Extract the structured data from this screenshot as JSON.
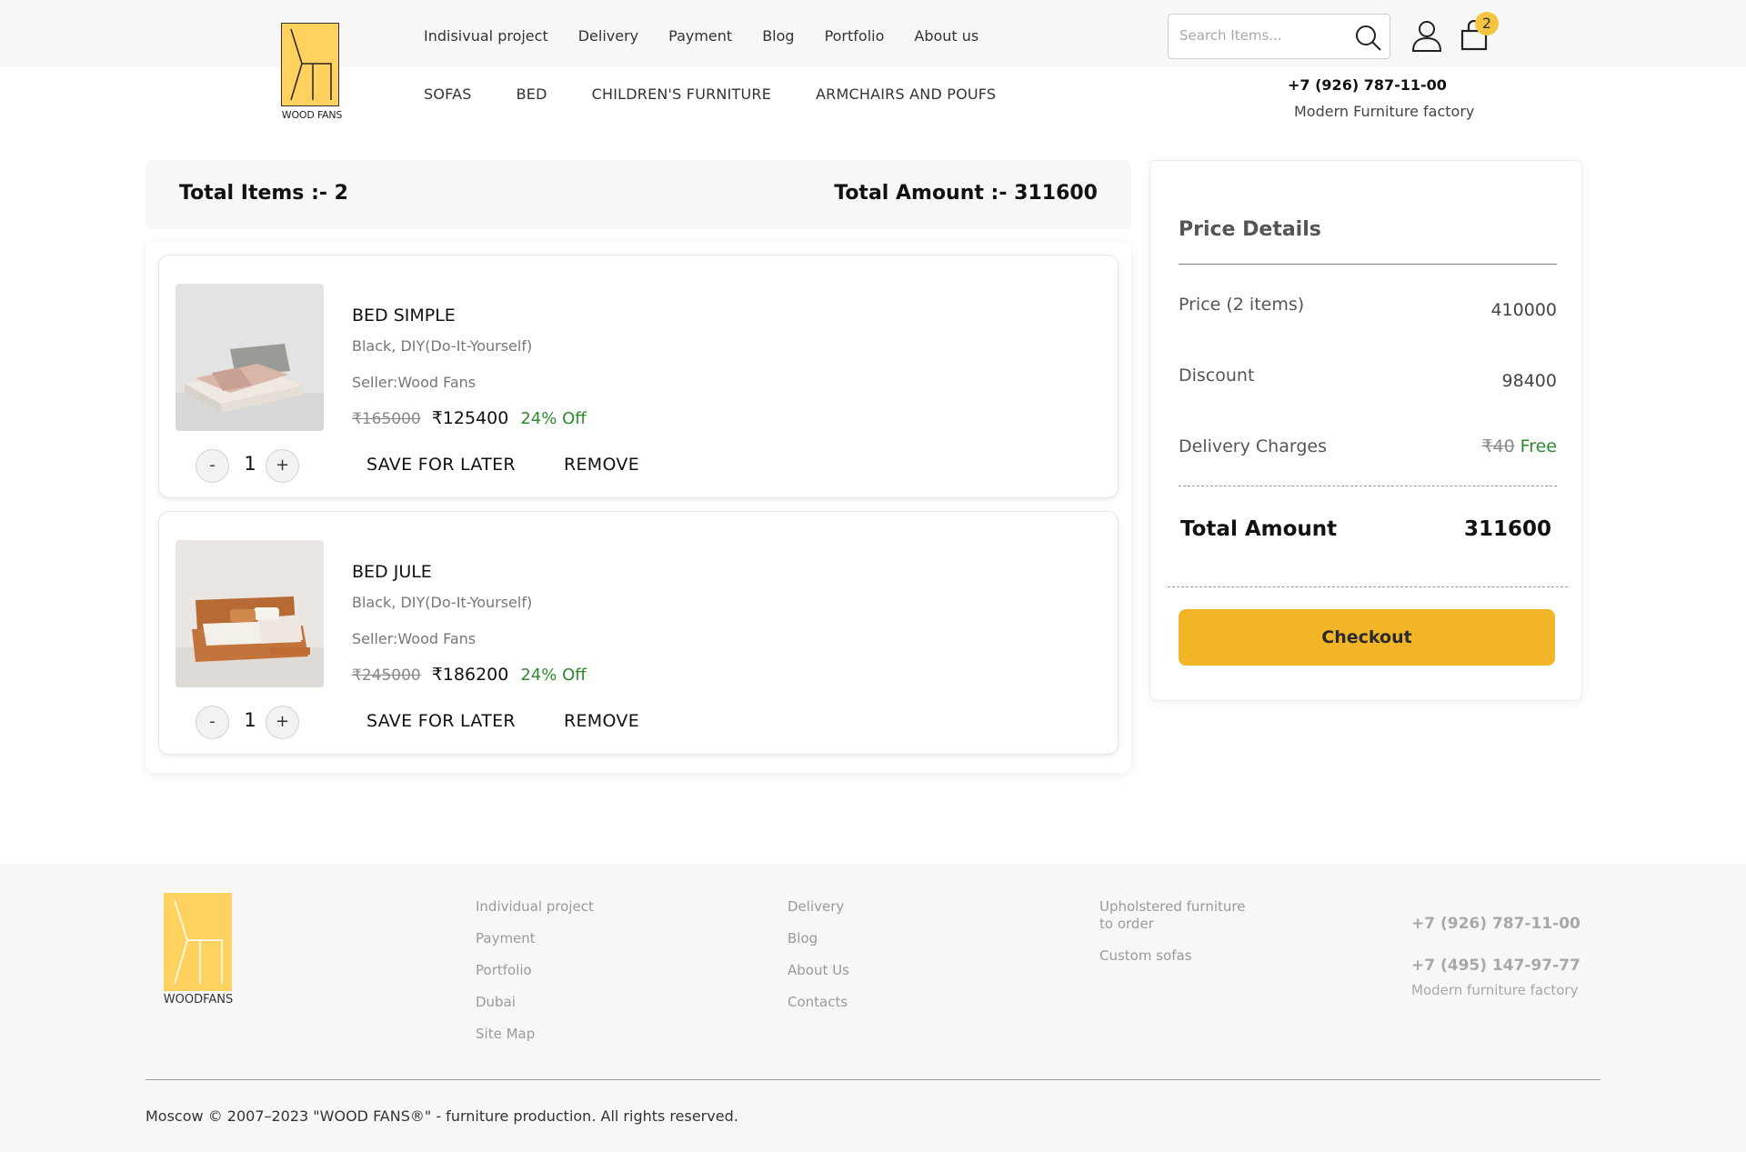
{
  "header": {
    "logo_text": "WOOD FANS",
    "nav_top": [
      "Indisivual project",
      "Delivery",
      "Payment",
      "Blog",
      "Portfolio",
      "About us"
    ],
    "nav_categories": [
      "SOFAS",
      "BED",
      "CHILDREN'S FURNITURE",
      "ARMCHAIRS AND POUFS"
    ],
    "search_placeholder": "Search Items...",
    "cart_count": "2",
    "phone": "+7 (926) 787-11-00",
    "tagline": "Modern Furniture factory"
  },
  "cart": {
    "total_items_label": "Total Items :- 2",
    "total_amount_label": "Total Amount :- 311600",
    "items": [
      {
        "name": "BED SIMPLE",
        "variant": "Black, DIY(Do-It-Yourself)",
        "seller": "Seller:Wood Fans",
        "old_price": "₹165000",
        "price": "₹125400",
        "discount": "24% Off",
        "qty": "1",
        "minus": "-",
        "plus": "+",
        "save_label": "SAVE FOR LATER",
        "remove_label": "REMOVE"
      },
      {
        "name": "BED JULE",
        "variant": "Black, DIY(Do-It-Yourself)",
        "seller": "Seller:Wood Fans",
        "old_price": "₹245000",
        "price": "₹186200",
        "discount": "24% Off",
        "qty": "1",
        "minus": "-",
        "plus": "+",
        "save_label": "SAVE FOR LATER",
        "remove_label": "REMOVE"
      }
    ]
  },
  "price_details": {
    "title": "Price Details",
    "price_label": "Price (2 items)",
    "price_value": "410000",
    "discount_label": "Discount",
    "discount_value": "98400",
    "delivery_label": "Delivery Charges",
    "delivery_old": "₹40",
    "delivery_value": "Free",
    "total_label": "Total Amount",
    "total_value": "311600",
    "checkout_label": "Checkout"
  },
  "footer": {
    "logo_text": "WOODFANS",
    "col1": [
      "Individual project",
      "Payment",
      "Portfolio",
      "Dubai",
      "Site Map"
    ],
    "col2": [
      "Delivery",
      "Blog",
      "About Us",
      "Contacts"
    ],
    "col3": [
      "Upholstered furniture to order",
      "Custom sofas"
    ],
    "phone1": "+7 (926) 787-11-00",
    "phone2": "+7 (495) 147-97-77",
    "tagline": "Modern furniture factory",
    "copyright": "Moscow © 2007–2023 \"WOOD FANS®\" - furniture production. All rights reserved."
  },
  "colors": {
    "accent": "#f3b528",
    "logo_yellow": "#ffd25f",
    "discount_green": "#2d8a2d"
  }
}
